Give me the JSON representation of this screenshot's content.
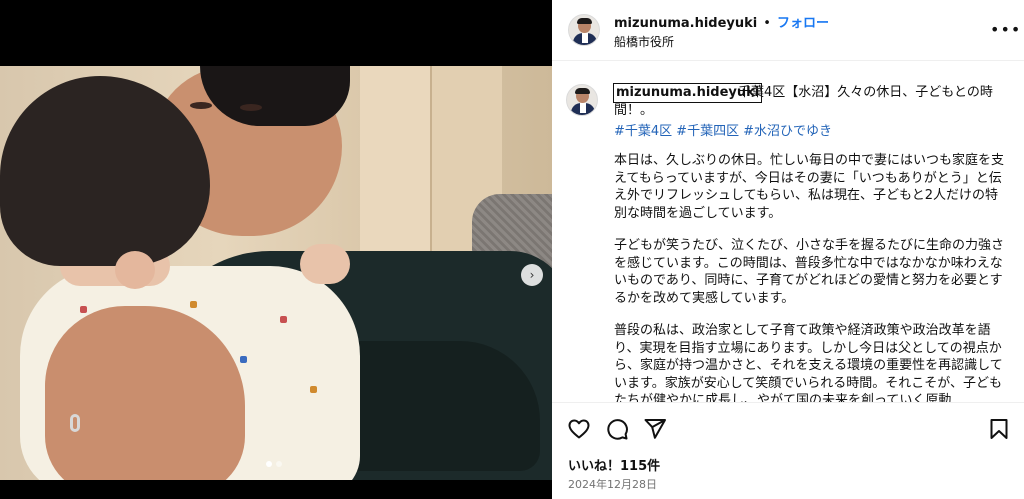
{
  "header": {
    "username": "mizunuma.hideyuki",
    "separator": "•",
    "follow_label": "フォロー",
    "location": "船橋市役所",
    "more_label": "•••"
  },
  "caption": {
    "username": "mizunuma.hideyuki",
    "text": "千葉4区【水沼】久々の休日、子どもとの時間！。",
    "hashtags": [
      "#千葉4区",
      "#千葉四区",
      "#水沼ひでゆき"
    ],
    "paragraphs": [
      "本日は、久しぶりの休日。忙しい毎日の中で妻にはいつも家庭を支えてもらっていますが、今日はその妻に「いつもありがとう」と伝え外でリフレッシュしてもらい、私は現在、子どもと2人だけの特別な時間を過ごしています。",
      "子どもが笑うたび、泣くたび、小さな手を握るたびに生命の力強さを感じています。この時間は、普段多忙な中ではなかなか味わえないものであり、同時に、子育てがどれほどの愛情と努力を必要とするかを改めて実感しています。",
      "普段の私は、政治家として子育て政策や経済政策や政治改革を語り、実現を目指す立場にあります。しかし今日は父としての視点から、家庭が持つ温かさと、それを支える環境の重要性を再認識しています。家族が安心して笑顔でいられる時間。それこそが、子どもたちが健やかに成長し、やがて国の未来を創っていく原動"
    ]
  },
  "media": {
    "next_label": "›",
    "slide_count": 2,
    "active_slide": 1
  },
  "actions": {
    "like_icon": "heart-icon",
    "comment_icon": "comment-icon",
    "share_icon": "send-icon",
    "save_icon": "bookmark-icon"
  },
  "likes_text": "いいね！115件",
  "date_text": "2024年12月28日"
}
